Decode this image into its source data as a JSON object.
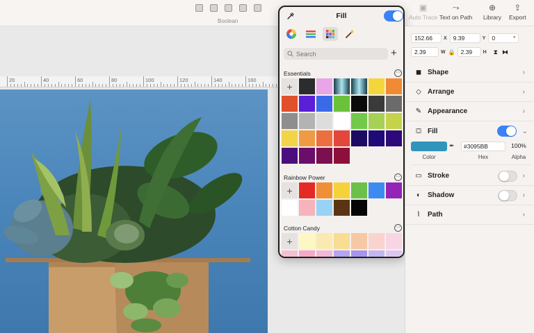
{
  "toolbar": {
    "boolean_label": "Boolean",
    "auto_trace_label": "Auto Trace",
    "text_on_path_label": "Text on Path",
    "library_label": "Library",
    "export_label": "Export"
  },
  "ruler": {
    "ticks": [
      "20",
      "40",
      "60",
      "80",
      "100",
      "120",
      "140",
      "160"
    ]
  },
  "fill_popover": {
    "title": "Fill",
    "enabled": true,
    "search_placeholder": "Search",
    "sections": [
      {
        "name": "Essentials",
        "swatches": [
          "#2c2c2e",
          "#e8a6e8",
          "gradient:#1b3d4a-#a8e6f0",
          "gradient:#1b3d4a-#a8e6f0",
          "#f5d53c",
          "#ee8b33",
          "#e0502a",
          "#5a1fd6",
          "#3b6ae8",
          "#6cc13a",
          "#0b0b0b",
          "#3a3a3a",
          "#6b6b6b",
          "#8e8e8e",
          "#b3b3b3",
          "#dddddd",
          "#ffffff",
          "#73c94b",
          "#a6d155",
          "#c4d34a",
          "#f2d34a",
          "#ef9b43",
          "#ec6f3f",
          "#e3473b",
          "#1c0b63",
          "#1f0a78",
          "#2d0a7a",
          "#4a0f7d",
          "#6a0e6a",
          "#7b0f4f",
          "#8c1039"
        ]
      },
      {
        "name": "Rainbow Power",
        "swatches": [
          "#e52a25",
          "#f08f37",
          "#f5d23c",
          "#6cc14a",
          "#3d8bf0",
          "#9423b8",
          "#ffffff",
          "#f7b3bb",
          "#98d3f5",
          "#5a3413",
          "#050505"
        ]
      },
      {
        "name": "Cotton Candy",
        "swatches": [
          "#fdf7c6",
          "#fbeab0",
          "#f8dd92",
          "#f6c9a4",
          "#f9d3cd",
          "#f7d5e4",
          "#f4c1d4",
          "#f6a9c5",
          "#f3b6d7",
          "#b7a3ef",
          "#a994ec",
          "#c4b6f0",
          "#ddc7f2"
        ]
      }
    ]
  },
  "inspector": {
    "x_value": "152.66",
    "x_label": "X",
    "y_value": "9.39",
    "y_label": "Y",
    "rotation_value": "0",
    "rotation_unit": "°",
    "w_value": "2.39",
    "w_label": "W",
    "h_value": "2.39",
    "h_label": "H",
    "rows": {
      "shape": "Shape",
      "arrange": "Arrange",
      "appearance": "Appearance",
      "fill": "Fill",
      "stroke": "Stroke",
      "shadow": "Shadow",
      "path": "Path"
    },
    "fill_enabled": true,
    "stroke_enabled": false,
    "shadow_enabled": false,
    "fill_color": "#3095BB",
    "fill_hex": "#3095BB",
    "fill_alpha": "100%",
    "color_label": "Color",
    "hex_label": "Hex",
    "alpha_label": "Alpha"
  }
}
